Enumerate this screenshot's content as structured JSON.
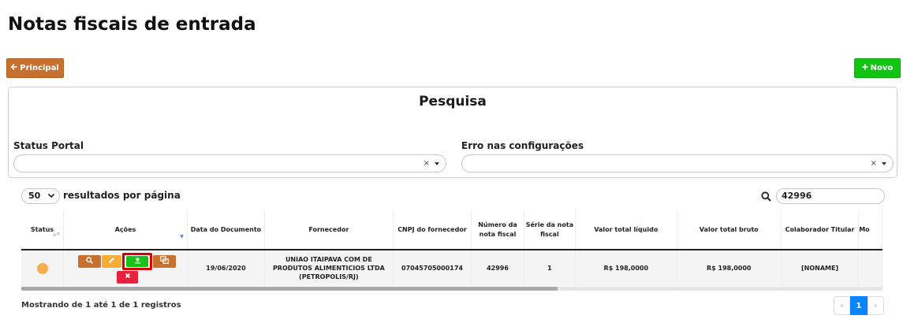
{
  "page": {
    "title": "Notas fiscais de entrada"
  },
  "toolbar": {
    "principal_label": "Principal",
    "novo_label": "Novo"
  },
  "search_panel": {
    "title": "Pesquisa",
    "status_portal_label": "Status Portal",
    "erro_config_label": "Erro nas configurações",
    "clear_symbol": "×"
  },
  "table_controls": {
    "page_length_value": "50",
    "page_length_label": "resultados por página",
    "search_value": "42996"
  },
  "table": {
    "columns": [
      "Status",
      "Ações",
      "Data do Documento",
      "Fornecedor",
      "CNPJ do fornecedor",
      "Número da nota fiscal",
      "Série da nota fiscal",
      "Valor total líquido",
      "Valor total bruto",
      "Colaborador Titular",
      "Mo"
    ],
    "rows": [
      {
        "status": "orange",
        "data_documento": "19/06/2020",
        "fornecedor": "UNIAO ITAIPAVA COM DE PRODUTOS ALIMENTICIOS LTDA (PETROPOLIS/RJ)",
        "cnpj": "07045705000174",
        "numero_nota": "42996",
        "serie": "1",
        "valor_liquido": "R$ 198,0000",
        "valor_bruto": "R$ 198,0000",
        "colaborador": "[NONAME]",
        "mo": ""
      }
    ],
    "action_icons": [
      "search-icon",
      "pencil-icon",
      "upload-icon",
      "detail-icon",
      "delete-icon"
    ]
  },
  "footer": {
    "info": "Mostrando de 1 até 1 de 1 registros",
    "pagination": {
      "prev": "‹",
      "current": "1",
      "next": "›"
    }
  },
  "colors": {
    "primary_brown": "#c8702f",
    "green": "#12c412",
    "orange_dot": "#f5ad4e",
    "edit_yellow": "#f5ad33",
    "delete_red": "#e8213f",
    "highlight_red": "#d40000",
    "pager_blue": "#0b84ff"
  }
}
